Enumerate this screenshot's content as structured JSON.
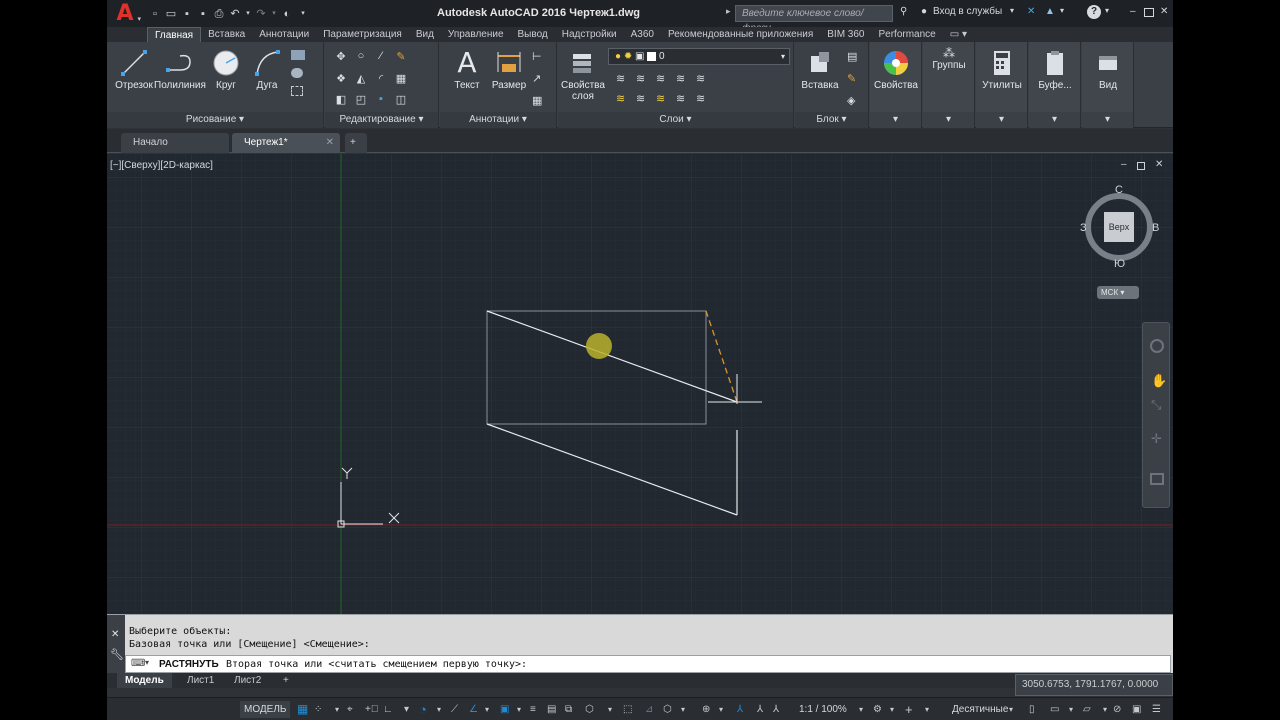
{
  "title": {
    "app_title": "Autodesk AutoCAD 2016    Чертеж1.dwg",
    "search_placeholder": "Введите ключевое слово/фразу",
    "signin_label": "Вход в службы"
  },
  "ribbon_tabs": [
    "Главная",
    "Вставка",
    "Аннотации",
    "Параметризация",
    "Вид",
    "Управление",
    "Вывод",
    "Надстройки",
    "A360",
    "Рекомендованные приложения",
    "BIM 360",
    "Performance"
  ],
  "ribbon": {
    "draw": {
      "title": "Рисование",
      "line": "Отрезок",
      "polyline": "Полилиния",
      "circle": "Круг",
      "arc": "Дуга"
    },
    "modify": {
      "title": "Редактирование"
    },
    "annotation": {
      "title": "Аннотации",
      "text": "Текст",
      "dimension": "Размер"
    },
    "layers": {
      "title": "Слои",
      "layer_props": "Свойства слоя",
      "current_layer": "0"
    },
    "block": {
      "title": "Блок",
      "insert": "Вставка"
    },
    "properties": "Свойства",
    "groups": "Группы",
    "utilities": "Утилиты",
    "clipboard": "Буфе...",
    "view": "Вид"
  },
  "doc_tabs": {
    "start": "Начало",
    "drawing": "Чертеж1*"
  },
  "viewport": {
    "label": "[−][Сверху][2D-каркас]",
    "viewcube": {
      "n": "С",
      "s": "Ю",
      "w": "З",
      "e": "В",
      "face": "Верх",
      "ucs": "МСК"
    },
    "ucs_x": "X",
    "ucs_y": "Y"
  },
  "command": {
    "line1": "Выберите объекты:",
    "line2": "Базовая точка или [Смещение] <Смещение>:",
    "prompt_cmd": "РАСТЯНУТЬ",
    "prompt_text": "Вторая точка или <считать смещением первую точку>:"
  },
  "layout_tabs": [
    "Модель",
    "Лист1",
    "Лист2"
  ],
  "status": {
    "coords": "3050.6753, 1791.1767, 0.0000",
    "model": "МОДЕЛЬ",
    "scale": "1:1 / 100%",
    "units": "Десятичные"
  },
  "colors": {
    "accent": "#1f8dd6",
    "canvas": "#212830",
    "grid_major": "#2e3945",
    "x_axis": "#7a1e1e",
    "y_axis": "#1e6a22"
  }
}
